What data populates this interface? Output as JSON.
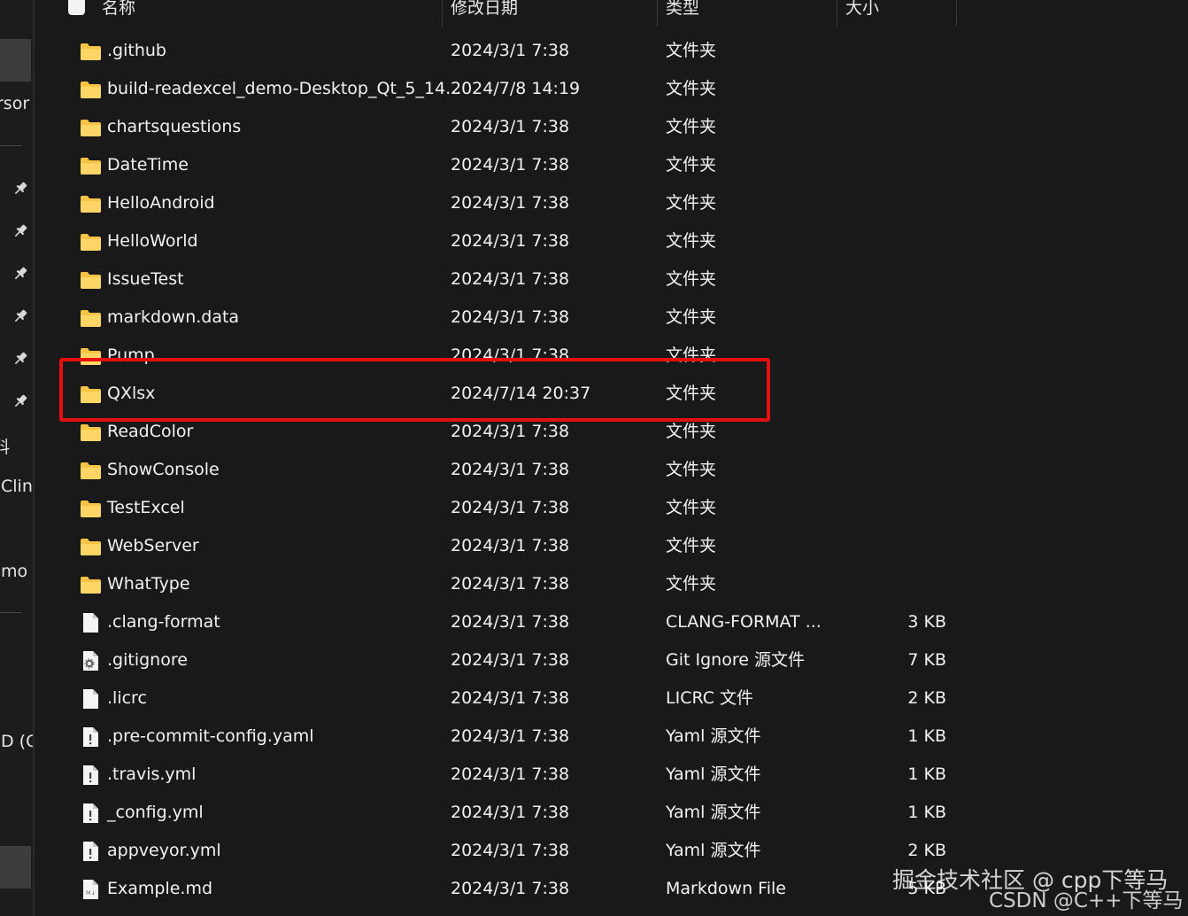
{
  "colors": {
    "background": "#191919",
    "folder": "#f6c445",
    "highlight": "#e60f0f",
    "text": "#f2f2f2"
  },
  "nav": {
    "label_1": "rsor",
    "label_2": "料",
    "label_3": "Clin",
    "label_4": "mo",
    "label_5": "D (C",
    "pins": [
      "pin-icon",
      "pin-icon",
      "pin-icon",
      "pin-icon",
      "pin-icon",
      "pin-icon"
    ]
  },
  "header": {
    "name": "名称",
    "date": "修改日期",
    "type": "类型",
    "size": "大小"
  },
  "files": [
    {
      "name": ".github",
      "date": "2024/3/1 7:38",
      "type": "文件夹",
      "size": "",
      "icon": "folder-icon"
    },
    {
      "name": "build-readexcel_demo-Desktop_Qt_5_14...",
      "date": "2024/7/8 14:19",
      "type": "文件夹",
      "size": "",
      "icon": "folder-icon"
    },
    {
      "name": "chartsquestions",
      "date": "2024/3/1 7:38",
      "type": "文件夹",
      "size": "",
      "icon": "folder-icon"
    },
    {
      "name": "DateTime",
      "date": "2024/3/1 7:38",
      "type": "文件夹",
      "size": "",
      "icon": "folder-icon"
    },
    {
      "name": "HelloAndroid",
      "date": "2024/3/1 7:38",
      "type": "文件夹",
      "size": "",
      "icon": "folder-icon"
    },
    {
      "name": "HelloWorld",
      "date": "2024/3/1 7:38",
      "type": "文件夹",
      "size": "",
      "icon": "folder-icon"
    },
    {
      "name": "IssueTest",
      "date": "2024/3/1 7:38",
      "type": "文件夹",
      "size": "",
      "icon": "folder-icon"
    },
    {
      "name": "markdown.data",
      "date": "2024/3/1 7:38",
      "type": "文件夹",
      "size": "",
      "icon": "folder-icon"
    },
    {
      "name": "Pump",
      "date": "2024/3/1 7:38",
      "type": "文件夹",
      "size": "",
      "icon": "folder-icon"
    },
    {
      "name": "QXlsx",
      "date": "2024/7/14 20:37",
      "type": "文件夹",
      "size": "",
      "icon": "folder-icon"
    },
    {
      "name": "ReadColor",
      "date": "2024/3/1 7:38",
      "type": "文件夹",
      "size": "",
      "icon": "folder-icon"
    },
    {
      "name": "ShowConsole",
      "date": "2024/3/1 7:38",
      "type": "文件夹",
      "size": "",
      "icon": "folder-icon"
    },
    {
      "name": "TestExcel",
      "date": "2024/3/1 7:38",
      "type": "文件夹",
      "size": "",
      "icon": "folder-icon"
    },
    {
      "name": "WebServer",
      "date": "2024/3/1 7:38",
      "type": "文件夹",
      "size": "",
      "icon": "folder-icon"
    },
    {
      "name": "WhatType",
      "date": "2024/3/1 7:38",
      "type": "文件夹",
      "size": "",
      "icon": "folder-icon"
    },
    {
      "name": ".clang-format",
      "date": "2024/3/1 7:38",
      "type": "CLANG-FORMAT ...",
      "size": "3 KB",
      "icon": "file-icon"
    },
    {
      "name": ".gitignore",
      "date": "2024/3/1 7:38",
      "type": "Git Ignore 源文件",
      "size": "7 KB",
      "icon": "gear-file-icon"
    },
    {
      "name": ".licrc",
      "date": "2024/3/1 7:38",
      "type": "LICRC 文件",
      "size": "2 KB",
      "icon": "file-icon"
    },
    {
      "name": ".pre-commit-config.yaml",
      "date": "2024/3/1 7:38",
      "type": "Yaml 源文件",
      "size": "1 KB",
      "icon": "yaml-file-icon"
    },
    {
      "name": ".travis.yml",
      "date": "2024/3/1 7:38",
      "type": "Yaml 源文件",
      "size": "1 KB",
      "icon": "yaml-file-icon"
    },
    {
      "name": "_config.yml",
      "date": "2024/3/1 7:38",
      "type": "Yaml 源文件",
      "size": "1 KB",
      "icon": "yaml-file-icon"
    },
    {
      "name": "appveyor.yml",
      "date": "2024/3/1 7:38",
      "type": "Yaml 源文件",
      "size": "2 KB",
      "icon": "yaml-file-icon"
    },
    {
      "name": "Example.md",
      "date": "2024/3/1 7:38",
      "type": "Markdown File",
      "size": "5 KB",
      "icon": "markdown-file-icon"
    }
  ],
  "highlighted_row": 9,
  "watermark": {
    "line_1": "掘金技术社区 @ cpp下等马",
    "line_2": "CSDN @C++下等马"
  }
}
